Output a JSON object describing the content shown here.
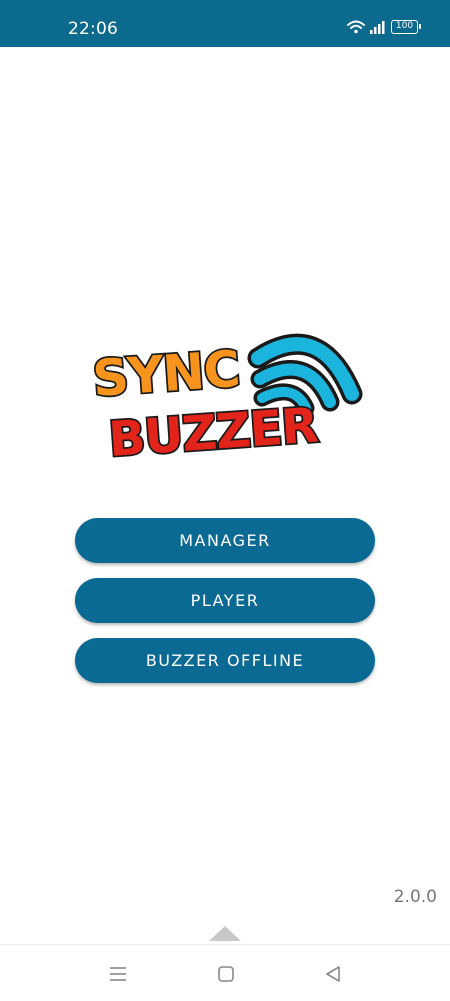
{
  "status_bar": {
    "time": "22:06",
    "battery": "100",
    "background": "#0c6a8e"
  },
  "logo": {
    "line1": "SYNC",
    "line2": "BUZZER",
    "colors": {
      "sync": "#f7941d",
      "buzzer": "#e3241b",
      "waves": "#1ab4dd",
      "outline": "#1a1a1a"
    }
  },
  "menu": {
    "manager_label": "MANAGER",
    "player_label": "PLAYER",
    "buzzer_offline_label": "BUZZER OFFLINE",
    "button_color": "#0a6a94"
  },
  "version": "2.0.0",
  "nav": {
    "icons": [
      "menu-icon",
      "home-icon",
      "back-icon"
    ]
  }
}
